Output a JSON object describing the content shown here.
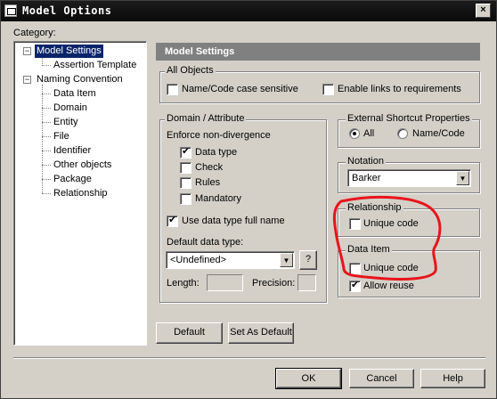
{
  "window": {
    "title": "Model Options",
    "close_glyph": "×"
  },
  "category_label": "Category:",
  "tree": {
    "model_settings": "Model Settings",
    "assertion_template": "Assertion Template",
    "naming_convention": "Naming Convention",
    "collapse_glyph": "−",
    "children": [
      "Data Item",
      "Domain",
      "Entity",
      "File",
      "Identifier",
      "Other objects",
      "Package",
      "Relationship"
    ]
  },
  "panel_title": "Model Settings",
  "all_objects": {
    "label": "All Objects",
    "name_code_case_sensitive": "Name/Code case sensitive",
    "enable_links": "Enable links to requirements"
  },
  "domain_attribute": {
    "label": "Domain / Attribute",
    "enforce_label": "Enforce non-divergence",
    "data_type": "Data type",
    "check": "Check",
    "rules": "Rules",
    "mandatory": "Mandatory",
    "use_full_name": "Use data type full name",
    "default_data_type_label": "Default data type:",
    "default_data_type_value": "<Undefined>",
    "browse_label": "?",
    "length_label": "Length:",
    "precision_label": "Precision:"
  },
  "external_shortcut": {
    "label": "External Shortcut Properties",
    "all": "All",
    "name_code": "Name/Code"
  },
  "notation": {
    "label": "Notation",
    "value": "Barker"
  },
  "relationship": {
    "label": "Relationship",
    "unique_code": "Unique code"
  },
  "data_item": {
    "label": "Data Item",
    "unique_code": "Unique code",
    "allow_reuse": "Allow reuse"
  },
  "buttons": {
    "default": "Default",
    "set_as_default": "Set As Default",
    "ok": "OK",
    "cancel": "Cancel",
    "help": "Help"
  },
  "icons": {
    "dropdown": "▼"
  },
  "colors": {
    "annotation": "#e8141c",
    "selection": "#0a246a",
    "header": "#808080"
  }
}
